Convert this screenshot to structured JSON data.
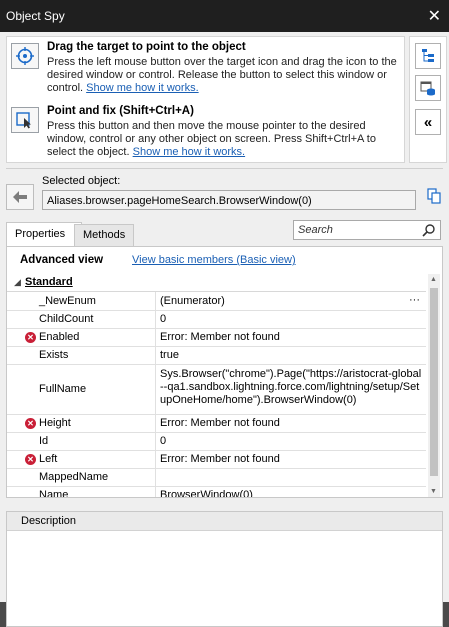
{
  "window": {
    "title": "Object Spy",
    "close_glyph": "✕"
  },
  "drag_option": {
    "heading": "Drag the target to point to the object",
    "description": "Press the left mouse button over the target icon and drag the icon to the desired window or control. Release the button to select this window or control.",
    "link": "Show me how it works."
  },
  "point_option": {
    "heading": "Point and fix (Shift+Ctrl+A)",
    "description": "Press this button and then move the mouse pointer to the desired window, control or any other object on screen. Press Shift+Ctrl+A to select the object.",
    "link": "Show me how it works."
  },
  "right_toolbar": [
    "object-tree-icon",
    "object-browser-icon",
    "collapse-icon"
  ],
  "collapse_glyph": "«",
  "selected": {
    "label": "Selected object:",
    "value": "Aliases.browser.pageHomeSearch.BrowserWindow(0)"
  },
  "tabs": [
    "Properties",
    "Methods"
  ],
  "search": {
    "placeholder": "Search"
  },
  "view": {
    "title": "Advanced view",
    "basic_link": "View basic members (Basic view)"
  },
  "category": "Standard",
  "properties": [
    {
      "name": "_NewEnum",
      "value": "(Enumerator)",
      "error": false,
      "ellipsis": "···"
    },
    {
      "name": "ChildCount",
      "value": "0",
      "error": false
    },
    {
      "name": "Enabled",
      "value": "Error: Member not found",
      "error": true
    },
    {
      "name": "Exists",
      "value": "true",
      "error": false
    },
    {
      "name": "FullName",
      "value": "Sys.Browser(\"chrome\").Page(\"https://aristocrat-global--qa1.sandbox.lightning.force.com/lightning/setup/SetupOneHome/home\").BrowserWindow(0)",
      "error": false
    },
    {
      "name": "Height",
      "value": "Error: Member not found",
      "error": true
    },
    {
      "name": "Id",
      "value": "0",
      "error": false
    },
    {
      "name": "Left",
      "value": "Error: Member not found",
      "error": true
    },
    {
      "name": "MappedName",
      "value": "",
      "error": false
    },
    {
      "name": "Name",
      "value": "BrowserWindow(0)",
      "error": false
    }
  ],
  "description_panel": {
    "title": "Description"
  }
}
